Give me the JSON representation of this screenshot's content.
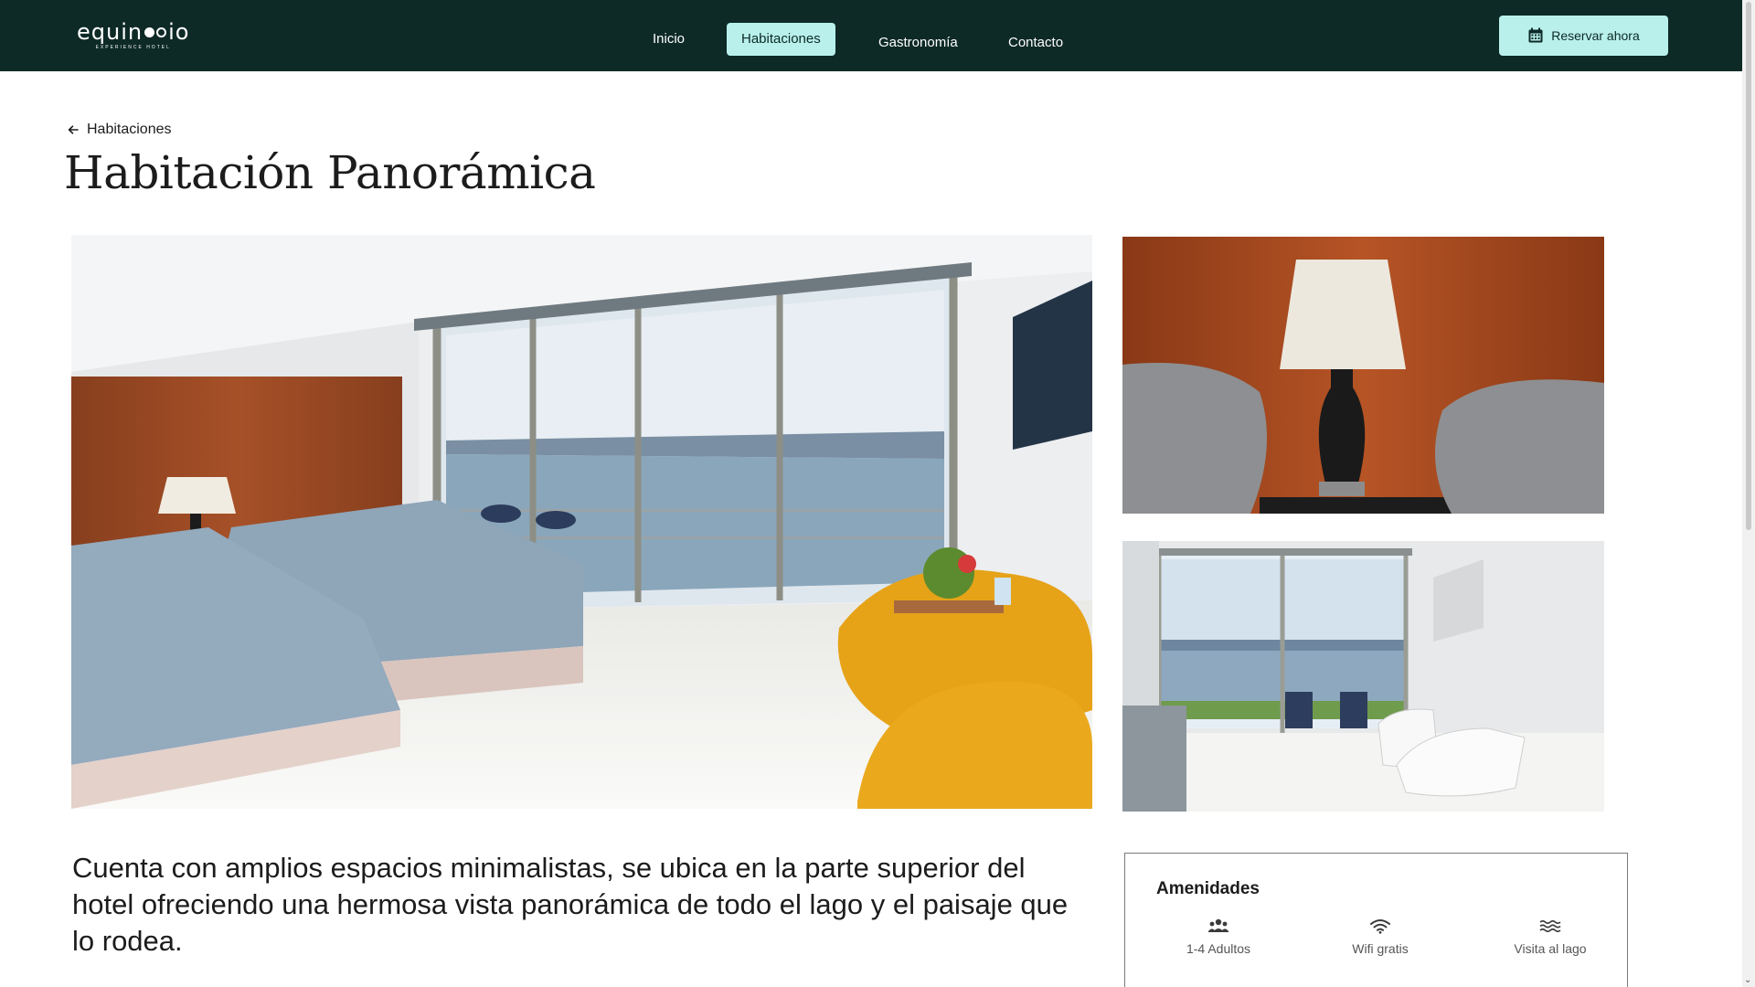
{
  "brand": {
    "logo_text": "equinoccio",
    "logo_subtitle": "EXPERIENCE HOTEL"
  },
  "nav": {
    "items": [
      {
        "label": "Inicio",
        "active": false
      },
      {
        "label": "Habitaciones",
        "active": true
      },
      {
        "label": "Gastronomía",
        "active": false
      },
      {
        "label": "Contacto",
        "active": false
      }
    ],
    "reserve_label": "Reservar ahora",
    "reserve_icon": "calendar-icon"
  },
  "breadcrumb": {
    "back_label": "Habitaciones",
    "back_icon": "arrow-left-icon"
  },
  "room": {
    "title": "Habitación Panorámica",
    "description": "Cuenta con amplios espacios minimalistas, se ubica en la parte superior del hotel ofreciendo una hermosa vista panorámica de todo el lago y el paisaje que lo rodea."
  },
  "amenities": {
    "title": "Amenidades",
    "items": [
      {
        "label": "1-4 Adultos",
        "icon": "people-icon"
      },
      {
        "label": "Wifi gratis",
        "icon": "wifi-icon"
      },
      {
        "label": "Visita al lago",
        "icon": "waves-icon"
      }
    ]
  },
  "colors": {
    "nav_bg": "#0d2a26",
    "accent": "#b9f0ec",
    "text": "#1c1c1c"
  }
}
